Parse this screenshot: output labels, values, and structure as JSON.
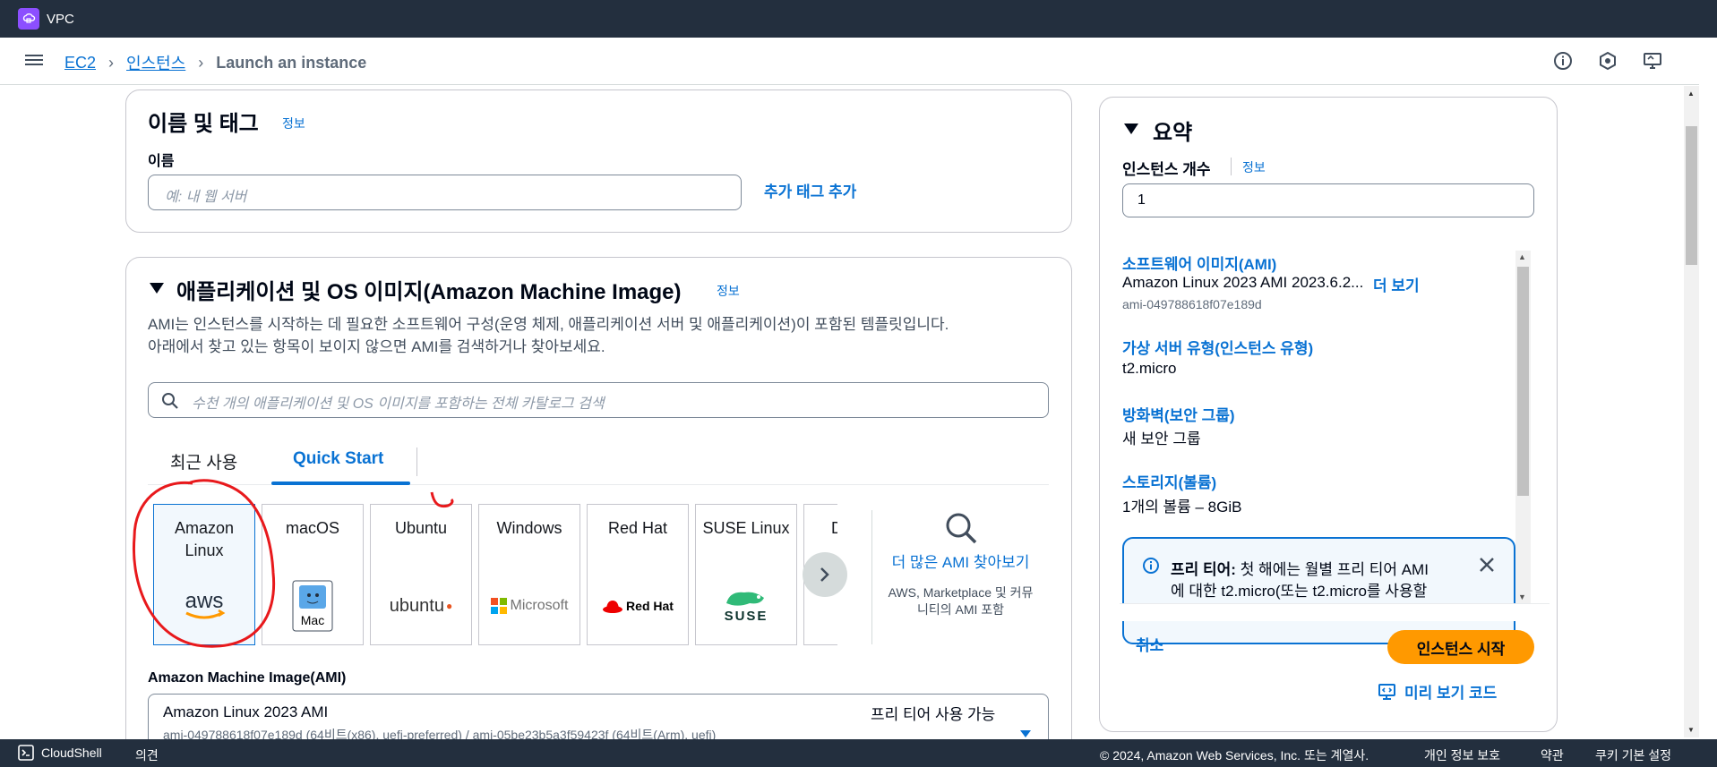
{
  "topbar": {
    "service": "VPC"
  },
  "breadcrumb": {
    "items": [
      "EC2",
      "인스턴스"
    ],
    "current": "Launch an instance"
  },
  "name_section": {
    "title": "이름 및 태그",
    "info": "정보",
    "name_label": "이름",
    "name_placeholder": "예: 내 웹 서버",
    "add_tag": "추가 태그 추가"
  },
  "ami_section": {
    "title": "애플리케이션 및 OS 이미지(Amazon Machine Image)",
    "info": "정보",
    "desc_line1": "AMI는 인스턴스를 시작하는 데 필요한 소프트웨어 구성(운영 체제, 애플리케이션 서버 및 애플리케이션)이 포함된 템플릿입니다.",
    "desc_line2": "아래에서 찾고 있는 항목이 보이지 않으면 AMI를 검색하거나 찾아보세요.",
    "search_placeholder": "수천 개의 애플리케이션 및 OS 이미지를 포함하는 전체 카탈로그 검색",
    "tabs": [
      "최근 사용",
      "Quick Start"
    ],
    "tiles": [
      {
        "label1": "Amazon",
        "label2": "Linux",
        "logo": "aws"
      },
      {
        "label1": "macOS",
        "label2": "",
        "logo": "Mac"
      },
      {
        "label1": "Ubuntu",
        "label2": "",
        "logo": "ubuntu"
      },
      {
        "label1": "Windows",
        "label2": "",
        "logo": "Microsoft"
      },
      {
        "label1": "Red Hat",
        "label2": "",
        "logo": "Red Hat"
      },
      {
        "label1": "SUSE Linux",
        "label2": "",
        "logo": "SUSE"
      },
      {
        "label1": "D",
        "label2": "",
        "logo": ""
      }
    ],
    "more_link": "더 많은 AMI 찾아보기",
    "more_sub": "AWS, Marketplace 및 커뮤니티의 AMI 포함",
    "ami_label": "Amazon Machine Image(AMI)",
    "ami_name": "Amazon Linux 2023 AMI",
    "ami_ids": "ami-049788618f07e189d (64비트(x86), uefi-preferred) / ami-05be23b5a3f59423f (64비트(Arm), uefi)",
    "ami_badge": "프리 티어 사용 가능"
  },
  "summary": {
    "title": "요약",
    "count_label": "인스턴스 개수",
    "info": "정보",
    "count_value": "1",
    "software_title": "소프트웨어 이미지(AMI)",
    "software_value": "Amazon Linux 2023 AMI 2023.6.2...",
    "software_more": "더 보기",
    "software_id": "ami-049788618f07e189d",
    "type_title": "가상 서버 유형(인스턴스 유형)",
    "type_value": "t2.micro",
    "firewall_title": "방화벽(보안 그룹)",
    "firewall_value": "새 보안 그룹",
    "storage_title": "스토리지(볼륨)",
    "storage_value": "1개의 볼륨 – 8GiB",
    "freetier_label": "프리 티어:",
    "freetier_text1": "첫 해에는 월별 프리 티어 AMI",
    "freetier_text2": "에 대한 t2.micro(또는 t2.micro를 사용할",
    "cancel": "취소",
    "launch": "인스턴스 시작",
    "preview": "미리 보기 코드"
  },
  "footer": {
    "cloudshell": "CloudShell",
    "feedback": "의견",
    "copyright": "© 2024, Amazon Web Services, Inc. 또는 계열사.",
    "privacy": "개인 정보 보호",
    "terms": "약관",
    "cookies": "쿠키 기본 설정"
  },
  "colors": {
    "link": "#0972d3",
    "launch": "#ff9900",
    "topbar": "#232f3e",
    "annotation": "#e8191c"
  }
}
